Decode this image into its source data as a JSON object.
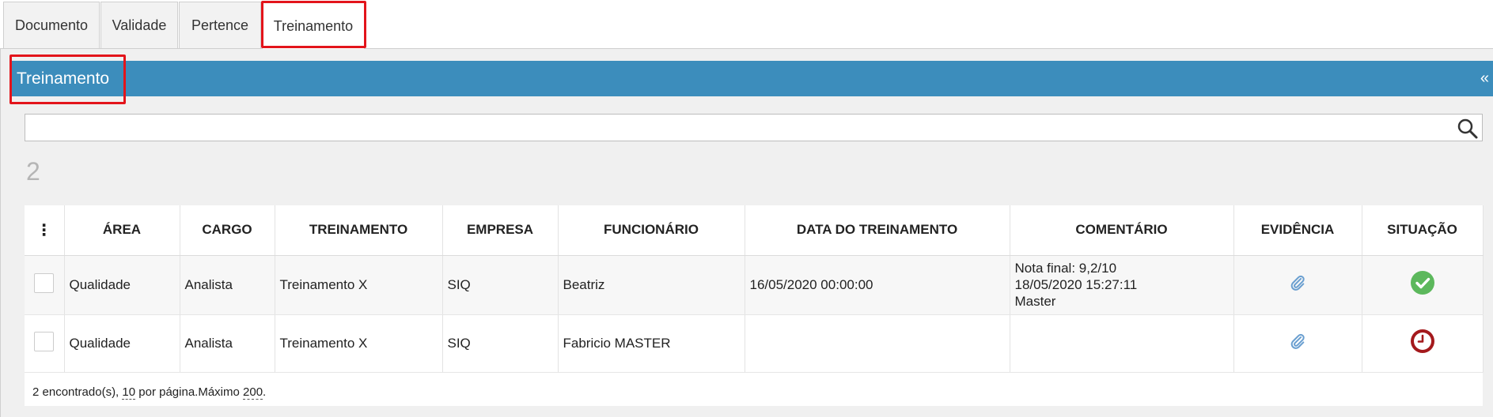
{
  "tabs": [
    {
      "label": "Documento"
    },
    {
      "label": "Validade"
    },
    {
      "label": "Pertence"
    },
    {
      "label": "Treinamento"
    }
  ],
  "panel": {
    "title": "Treinamento",
    "collapse_glyph": "«"
  },
  "search": {
    "value": "",
    "placeholder": "",
    "icon": "search-icon"
  },
  "result_count": "2",
  "table": {
    "columns": {
      "menu": "⋮",
      "area": "ÁREA",
      "cargo": "CARGO",
      "treinamento": "TREINAMENTO",
      "empresa": "EMPRESA",
      "funcionario": "FUNCIONÁRIO",
      "data": "DATA DO TREINAMENTO",
      "comentario": "COMENTÁRIO",
      "evidencia": "EVIDÊNCIA",
      "situacao": "SITUAÇÃO"
    },
    "rows": [
      {
        "area": "Qualidade",
        "cargo": "Analista",
        "treinamento": "Treinamento X",
        "empresa": "SIQ",
        "funcionario": "Beatriz",
        "data": "16/05/2020 00:00:00",
        "comentario": [
          "Nota final: 9,2/10",
          "18/05/2020 15:27:11",
          "Master"
        ],
        "evidencia_icon": "paperclip-icon",
        "situacao_icon": "check-circle-icon",
        "situacao_color": "#5cb85c"
      },
      {
        "area": "Qualidade",
        "cargo": "Analista",
        "treinamento": "Treinamento X",
        "empresa": "SIQ",
        "funcionario": "Fabricio MASTER",
        "data": "",
        "comentario": [],
        "evidencia_icon": "paperclip-icon",
        "situacao_icon": "clock-icon",
        "situacao_color": "#a4191c"
      }
    ]
  },
  "footer": {
    "found": "2 encontrado(s),",
    "per_page_value": "10",
    "per_page_text": "por página.Máximo",
    "max_value": "200",
    "end": "."
  },
  "colors": {
    "header_blue": "#3c8dbc",
    "highlight_red": "#e3141b",
    "paperclip": "#6a9fd0"
  }
}
